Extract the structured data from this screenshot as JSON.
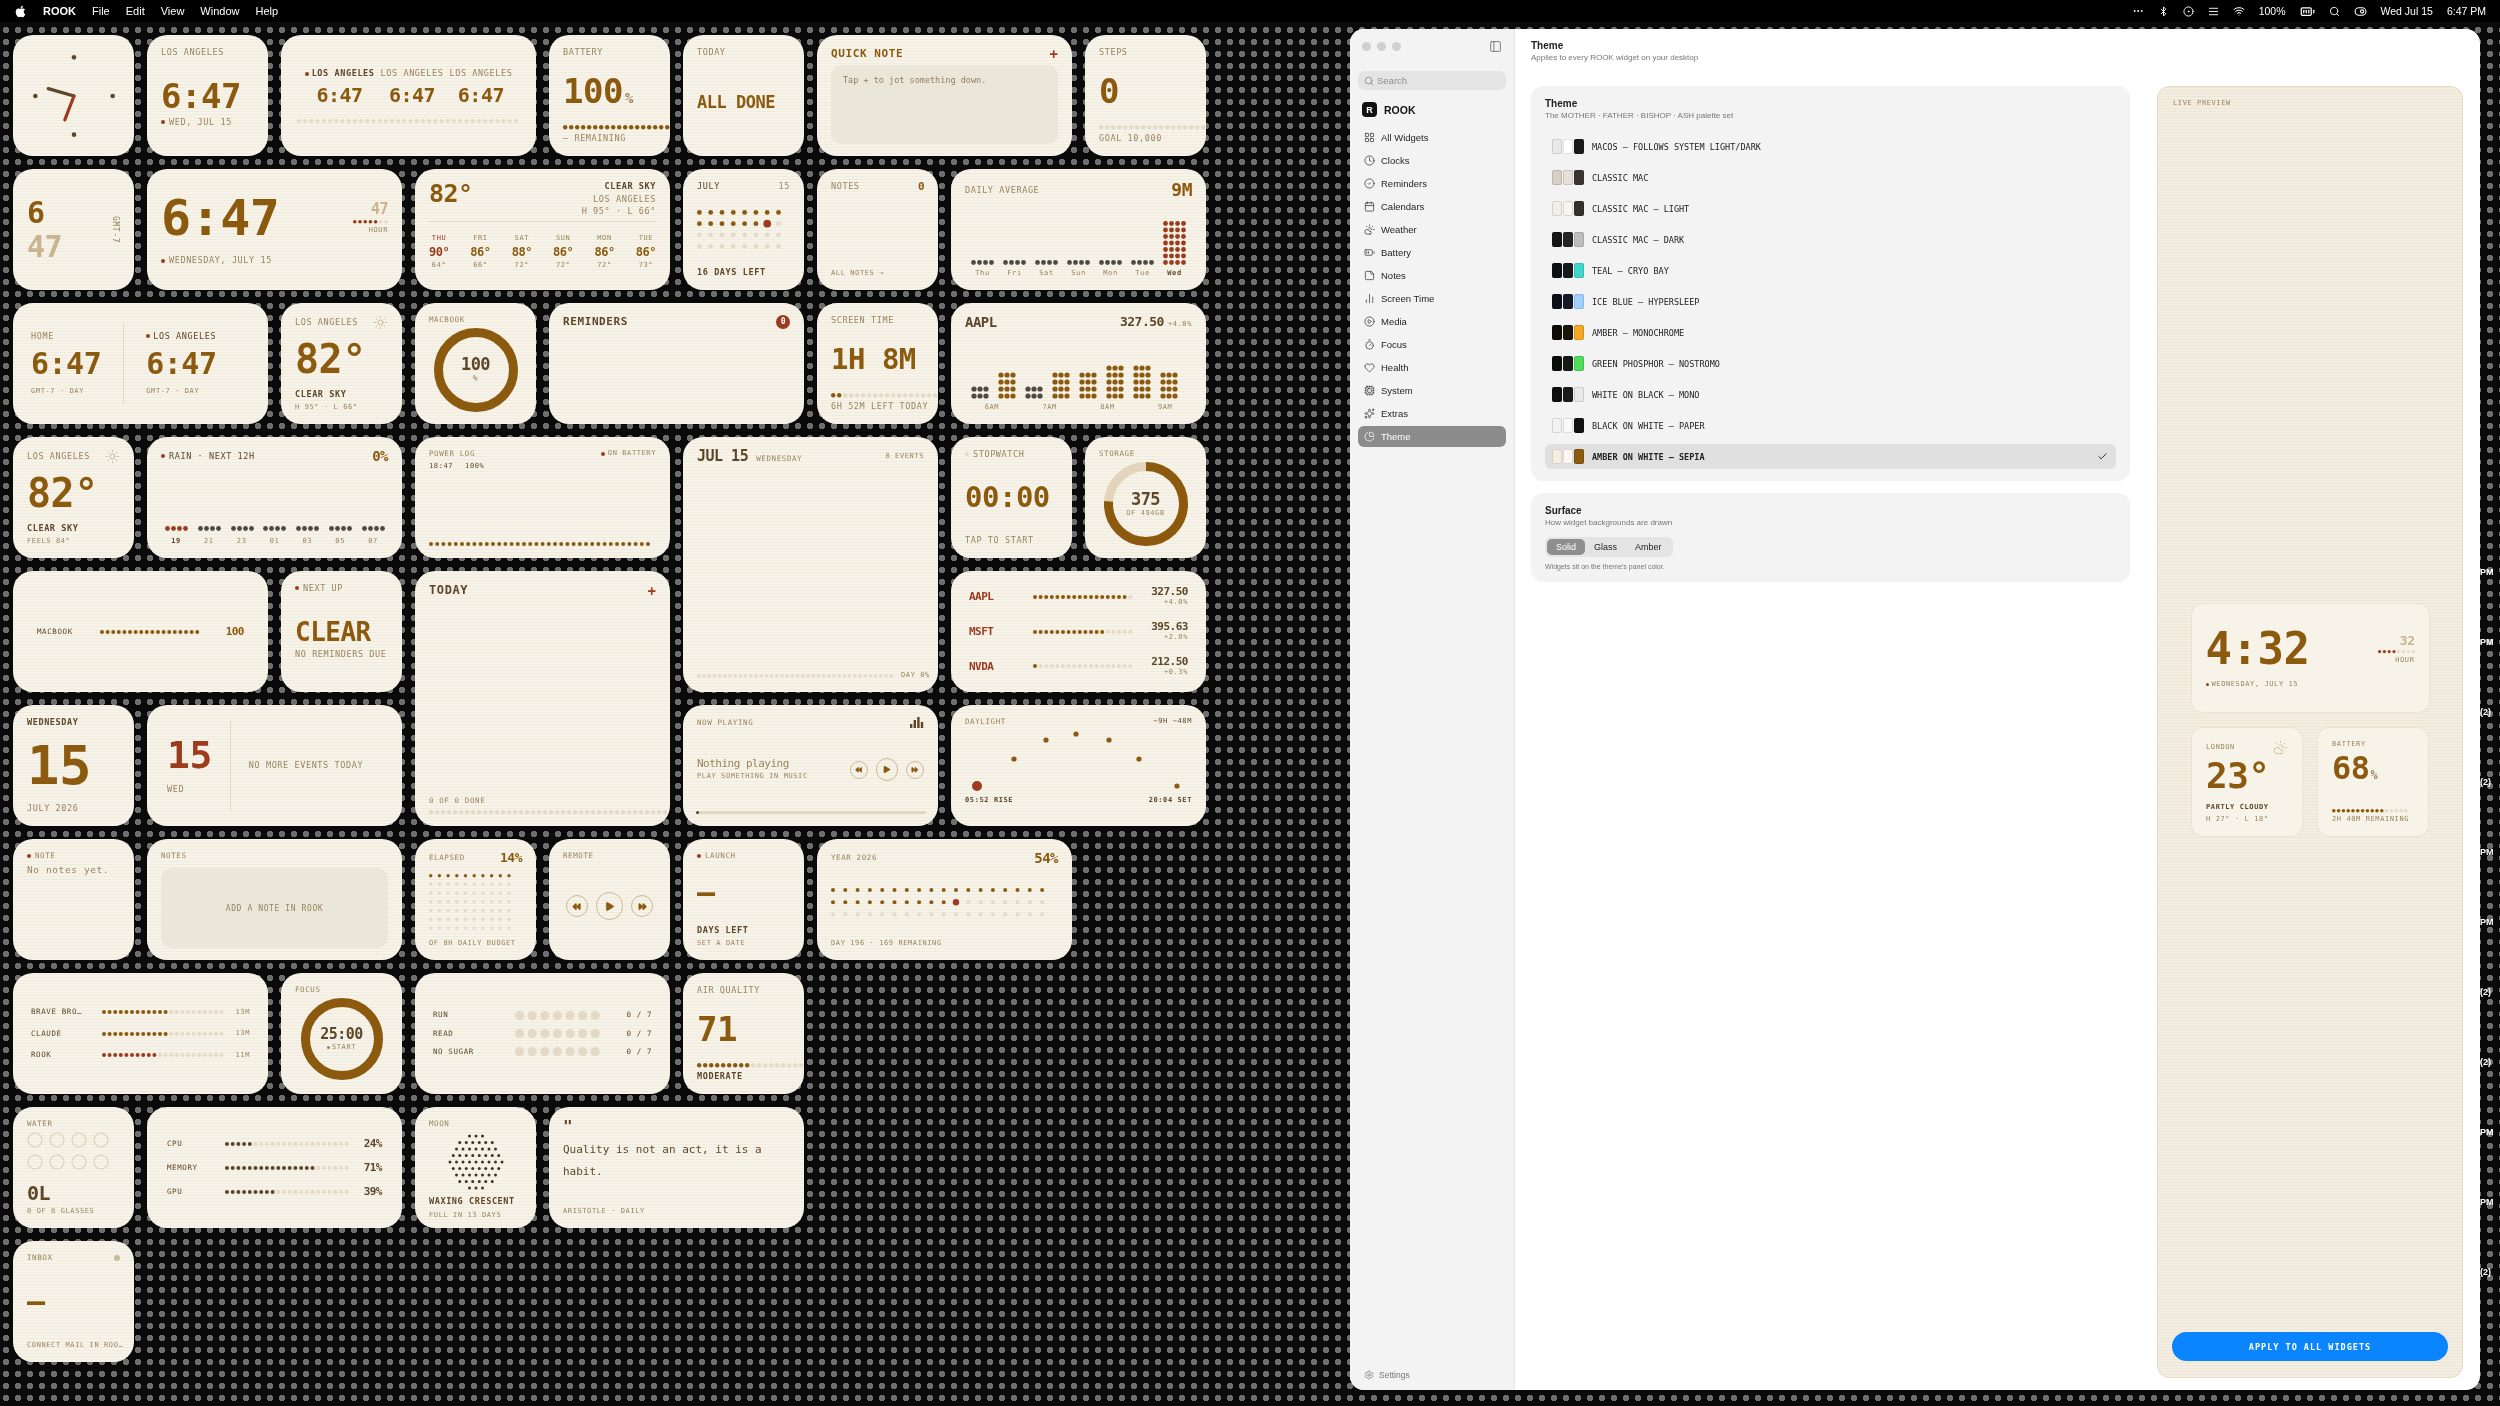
{
  "menu_bar": {
    "app": "ROOK",
    "menus": [
      "File",
      "Edit",
      "View",
      "Window",
      "Help"
    ],
    "battery": "100%",
    "date": "Wed Jul 15",
    "time": "6:47 PM"
  },
  "widgets": [
    {
      "kind": "analog-clock"
    },
    {
      "kind": "clock",
      "label": "LOS ANGELES",
      "time": "6:47",
      "date": "WED, JUL 15"
    },
    {
      "kind": "world-clocks",
      "cities": [
        {
          "label": "LOS ANGELES",
          "time": "6:47",
          "selected": true
        },
        {
          "label": "LOS ANGELES",
          "time": "6:47",
          "selected": false
        },
        {
          "label": "LOS ANGELES",
          "time": "6:47",
          "selected": false
        }
      ]
    },
    {
      "kind": "meter",
      "label": "BATTERY",
      "value": "100",
      "unit": "%",
      "note": "— REMAINING"
    },
    {
      "kind": "headline",
      "label": "TODAY",
      "value": "ALL DONE"
    },
    {
      "kind": "quick-note",
      "title": "QUICK NOTE",
      "action": "+",
      "placeholder": "Tap + to jot something down."
    },
    {
      "kind": "meter",
      "label": "STEPS",
      "value": "0",
      "note": "GOAL 10,000"
    },
    {
      "kind": "stacked-clock",
      "hour": "6",
      "minute": "47",
      "zone": "GMT-7"
    },
    {
      "kind": "big-clock",
      "time": "6:47",
      "seconds": "47",
      "unit": "HOUR",
      "date": "WEDNESDAY, JULY 15"
    },
    {
      "kind": "forecast",
      "temp": "82°",
      "condition": "CLEAR SKY",
      "city": "LOS ANGELES",
      "range": "H 95° · L 66°",
      "days": [
        {
          "day": "THU",
          "high": "90°",
          "low": "64°",
          "selected": true
        },
        {
          "day": "FRI",
          "high": "86°",
          "low": "66°",
          "selected": false
        },
        {
          "day": "SAT",
          "high": "88°",
          "low": "72°",
          "selected": false
        },
        {
          "day": "SUN",
          "high": "86°",
          "low": "72°",
          "selected": false
        },
        {
          "day": "MON",
          "high": "86°",
          "low": "72°",
          "selected": false
        },
        {
          "day": "TUE",
          "high": "86°",
          "low": "73°",
          "selected": false
        }
      ]
    },
    {
      "kind": "month",
      "month": "JULY",
      "day": "15",
      "note": "16 DAYS LEFT"
    },
    {
      "kind": "notes-count",
      "label": "NOTES",
      "count": "0",
      "footer": "ALL NOTES →"
    },
    {
      "kind": "daily-average",
      "label": "DAILY AVERAGE",
      "value": "9M",
      "days": [
        {
          "label": "Thu",
          "selected": false
        },
        {
          "label": "Fri",
          "selected": false
        },
        {
          "label": "Sat",
          "selected": false
        },
        {
          "label": "Sun",
          "selected": false
        },
        {
          "label": "Mon",
          "selected": false
        },
        {
          "label": "Tue",
          "selected": false
        },
        {
          "label": "Wed",
          "selected": true
        }
      ]
    },
    {
      "kind": "dual-clock",
      "zones": [
        {
          "label": "HOME",
          "time": "6:47",
          "note": "GMT-7 · DAY",
          "selected": false
        },
        {
          "label": "LOS ANGELES",
          "time": "6:47",
          "note": "GMT-7 · DAY",
          "selected": true
        }
      ]
    },
    {
      "kind": "weather",
      "city": "LOS ANGELES",
      "temp": "82°",
      "condition": "CLEAR SKY",
      "note": "H 95° · L 66°"
    },
    {
      "kind": "ring",
      "label": "MACBOOK",
      "value": "100",
      "unit": "%"
    },
    {
      "kind": "reminders",
      "title": "REMINDERS",
      "count": "0"
    },
    {
      "kind": "meter",
      "label": "SCREEN TIME",
      "value": "1H 8M",
      "level": 0.12,
      "note": "6H 52M LEFT TODAY"
    },
    {
      "kind": "stock-chart",
      "ticker": "AAPL",
      "price": "327.50",
      "change": "+4.0%",
      "hours": [
        "6AM",
        "7AM",
        "8AM",
        "9AM"
      ]
    },
    {
      "kind": "weather",
      "city": "LOS ANGELES",
      "temp": "82°",
      "condition": "CLEAR SKY",
      "note": "FEELS 84°"
    },
    {
      "kind": "rain",
      "label": "RAIN · NEXT 12H",
      "value": "0%",
      "hours": [
        {
          "label": "19",
          "selected": true
        },
        {
          "label": "21",
          "selected": false
        },
        {
          "label": "23",
          "selected": false
        },
        {
          "label": "01",
          "selected": false
        },
        {
          "label": "03",
          "selected": false
        },
        {
          "label": "05",
          "selected": false
        },
        {
          "label": "07",
          "selected": false
        }
      ]
    },
    {
      "kind": "power-log",
      "label": "POWER LOG",
      "status": "ON BATTERY",
      "entries": [
        {
          "time": "18:47",
          "value": "100%"
        }
      ]
    },
    {
      "kind": "day-calendar",
      "date": "JUL 15",
      "weekday": "WEDNESDAY",
      "count": "0 EVENTS",
      "footer": "DAY 0%"
    },
    {
      "kind": "stopwatch",
      "label": "STOPWATCH",
      "value": "00:00",
      "note": "TAP TO START"
    },
    {
      "kind": "ring",
      "label": "STORAGE",
      "value": "375",
      "unit": "OF 494GB"
    },
    {
      "kind": "battery-bar",
      "device": "MACBOOK",
      "value": "100"
    },
    {
      "kind": "headline",
      "label": "NEXT UP",
      "value": "CLEAR",
      "note": "NO REMINDERS DUE",
      "bullet": true
    },
    {
      "kind": "todo",
      "title": "TODAY",
      "action": "+",
      "footer": "0 OF 0 DONE"
    },
    {
      "kind": "stocks",
      "items": [
        {
          "ticker": "AAPL",
          "price": "327.50",
          "change": "+4.0%",
          "level": 0.95
        },
        {
          "ticker": "MSFT",
          "price": "395.63",
          "change": "+2.8%",
          "level": 0.7
        },
        {
          "ticker": "NVDA",
          "price": "212.50",
          "change": "+0.3%",
          "level": 0.05
        }
      ]
    },
    {
      "kind": "date",
      "weekday": "WEDNESDAY",
      "day": "15",
      "month": "JULY 2026"
    },
    {
      "kind": "agenda",
      "day": "15",
      "weekday": "WED",
      "message": "NO MORE EVENTS TODAY"
    },
    {
      "kind": "now-playing",
      "label": "NOW PLAYING",
      "title": "Nothing playing",
      "subtitle": "PLAY SOMETHING IN MUSIC"
    },
    {
      "kind": "daylight",
      "label": "DAYLIGHT",
      "value": "~9H ~48M",
      "sunrise": "05:52 RISE",
      "sunset": "20:04 SET"
    },
    {
      "kind": "note",
      "label": "NOTE",
      "text": "No notes yet.",
      "bullet": true
    },
    {
      "kind": "notes-add",
      "label": "NOTES",
      "action": "ADD A NOTE IN ROOK"
    },
    {
      "kind": "elapsed",
      "label": "ELAPSED",
      "value": "14%",
      "note": "OF 8H DAILY BUDGET"
    },
    {
      "kind": "remote",
      "label": "REMOTE"
    },
    {
      "kind": "countdown",
      "label": "LAUNCH",
      "value": "—",
      "title": "DAYS LEFT",
      "note": "SET A DATE",
      "bullet": true
    },
    {
      "kind": "year",
      "label": "YEAR 2026",
      "value": "54%",
      "note": "DAY 196 · 169 REMAINING"
    },
    {
      "kind": "usage",
      "items": [
        {
          "name": "BRAVE BRO…",
          "value": "13M",
          "level": 0.55,
          "color": "#8b5a0f"
        },
        {
          "name": "CLAUDE",
          "value": "13M",
          "level": 0.55,
          "color": "#8b5a0f"
        },
        {
          "name": "ROOK",
          "value": "11M",
          "level": 0.45,
          "color": "#9c3b1e"
        }
      ]
    },
    {
      "kind": "focus",
      "label": "FOCUS",
      "value": "25:00",
      "action": "START"
    },
    {
      "kind": "habits",
      "items": [
        {
          "name": "RUN",
          "count": "0 / 7"
        },
        {
          "name": "READ",
          "count": "0 / 7"
        },
        {
          "name": "NO SUGAR",
          "count": "0 / 7"
        }
      ]
    },
    {
      "kind": "meter",
      "label": "AIR QUALITY",
      "value": "71",
      "level": 0.5,
      "note": "MODERATE"
    },
    {
      "kind": "water",
      "label": "WATER",
      "value": "0L",
      "note": "0 OF 8 GLASSES"
    },
    {
      "kind": "system",
      "items": [
        {
          "name": "CPU",
          "value": "24%",
          "level": 0.24
        },
        {
          "name": "MEMORY",
          "value": "71%",
          "level": 0.71
        },
        {
          "name": "GPU",
          "value": "39%",
          "level": 0.39
        }
      ]
    },
    {
      "kind": "moon",
      "label": "MOON",
      "phase": "WAXING CRESCENT",
      "note": "FULL IN 13 DAYS"
    },
    {
      "kind": "quote",
      "mark": "\"",
      "text": "Quality is not an act, it is a habit.",
      "source": "ARISTOTLE · DAILY"
    },
    {
      "kind": "countdown",
      "label": "INBOX",
      "value": "—",
      "note": "CONNECT MAIL IN ROO…",
      "indicator": true
    }
  ],
  "settings_window": {
    "sidebar": {
      "search": {
        "placeholder": "Search"
      },
      "app": {
        "badge": "R",
        "name": "ROOK"
      },
      "items": [
        {
          "label": "All Widgets",
          "selected": false
        },
        {
          "label": "Clocks",
          "selected": false
        },
        {
          "label": "Reminders",
          "selected": false
        },
        {
          "label": "Calendars",
          "selected": false
        },
        {
          "label": "Weather",
          "selected": false
        },
        {
          "label": "Battery",
          "selected": false
        },
        {
          "label": "Notes",
          "selected": false
        },
        {
          "label": "Screen Time",
          "selected": false
        },
        {
          "label": "Media",
          "selected": false
        },
        {
          "label": "Focus",
          "selected": false
        },
        {
          "label": "Health",
          "selected": false
        },
        {
          "label": "System",
          "selected": false
        },
        {
          "label": "Extras",
          "selected": false
        },
        {
          "label": "Theme",
          "selected": true
        }
      ],
      "footer": "Settings"
    },
    "header": {
      "title": "Theme",
      "subtitle": "Applies to every ROOK widget on your desktop"
    },
    "theme_card": {
      "title": "Theme",
      "subtitle": "The MOTHER · FATHER · BISHOP · ASH palette set",
      "themes": [
        {
          "name": "MACOS — FOLLOWS SYSTEM LIGHT/DARK",
          "swatches": [
            {
              "color": "#e9e9e9"
            },
            {
              "color": "#ffffff"
            },
            {
              "color": "#1a1a1a"
            }
          ],
          "selected": false
        },
        {
          "name": "CLASSIC MAC",
          "swatches": [
            {
              "color": "#d6d0c4"
            },
            {
              "color": "#e6e1d6"
            },
            {
              "color": "#3b3530"
            }
          ],
          "selected": false
        },
        {
          "name": "CLASSIC MAC — LIGHT",
          "swatches": [
            {
              "color": "#f1eee6"
            },
            {
              "color": "#f7f5ef"
            },
            {
              "color": "#33302b"
            }
          ],
          "selected": false
        },
        {
          "name": "CLASSIC MAC — DARK",
          "swatches": [
            {
              "color": "#151515"
            },
            {
              "color": "#242424"
            },
            {
              "color": "#bdbdbd"
            }
          ],
          "selected": false
        },
        {
          "name": "TEAL — CRYO BAY",
          "swatches": [
            {
              "color": "#0e0f12"
            },
            {
              "color": "#161a1e"
            },
            {
              "color": "#3fd6c9"
            }
          ],
          "selected": false
        },
        {
          "name": "ICE BLUE — HYPERSLEEP",
          "swatches": [
            {
              "color": "#0c0f16"
            },
            {
              "color": "#141a26"
            },
            {
              "color": "#9fd0ff"
            }
          ],
          "selected": false
        },
        {
          "name": "AMBER — MONOCHROME",
          "swatches": [
            {
              "color": "#0d0b08"
            },
            {
              "color": "#1b140a"
            },
            {
              "color": "#f5a623"
            }
          ],
          "selected": false
        },
        {
          "name": "GREEN PHOSPHOR — NOSTROMO",
          "swatches": [
            {
              "color": "#0b0d0b"
            },
            {
              "color": "#141a14"
            },
            {
              "color": "#4fdc5a"
            }
          ],
          "selected": false
        },
        {
          "name": "WHITE ON BLACK — MONO",
          "swatches": [
            {
              "color": "#0e0e0e"
            },
            {
              "color": "#1b1b1b"
            },
            {
              "color": "#e8e8e8"
            }
          ],
          "selected": false
        },
        {
          "name": "BLACK ON WHITE — PAPER",
          "swatches": [
            {
              "color": "#f2f2f2"
            },
            {
              "color": "#fafafa"
            },
            {
              "color": "#111111"
            }
          ],
          "selected": false
        },
        {
          "name": "AMBER ON WHITE — SEPIA",
          "swatches": [
            {
              "color": "#f5efe2"
            },
            {
              "color": "#fbf8f1"
            },
            {
              "color": "#8b5a0f"
            }
          ],
          "selected": true
        }
      ]
    },
    "surface_card": {
      "title": "Surface",
      "subtitle": "How widget backgrounds are drawn",
      "options": [
        {
          "label": "Solid",
          "selected": true
        },
        {
          "label": "Glass",
          "selected": false
        },
        {
          "label": "Amber",
          "selected": false
        }
      ],
      "note": "Widgets sit on the theme's panel color."
    },
    "live_preview": {
      "label": "LIVE PREVIEW",
      "clock": {
        "time": "4:32",
        "seconds": "32",
        "unit": "HOUR",
        "date": "WEDNESDAY, JULY 15"
      },
      "weather": {
        "city": "LONDON",
        "temp": "23°",
        "condition": "PARTLY CLOUDY",
        "range": "H 27° · L 18°"
      },
      "battery": {
        "label": "BATTERY",
        "value": "68",
        "unit": "%",
        "level": 0.68,
        "note": "2H 40M REMAINING"
      },
      "apply_button": "APPLY TO ALL WIDGETS"
    }
  },
  "edge_labels": [
    "PM",
    "PM",
    "(2)",
    "(2)",
    "PM",
    "PM",
    "(2)",
    "(2)",
    "PM",
    "PM",
    "(2)"
  ]
}
